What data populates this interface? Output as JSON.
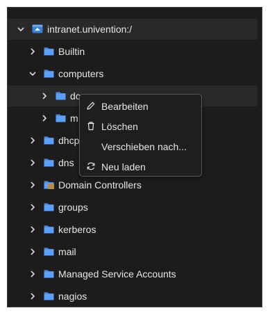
{
  "tree": {
    "root": {
      "label": "intranet.univention:/",
      "icon": "domain-root-icon"
    },
    "items": [
      {
        "label": "Builtin",
        "icon": "folder-icon",
        "expanded": false
      },
      {
        "label": "computers",
        "icon": "folder-icon",
        "expanded": true
      },
      {
        "label": "dc",
        "icon": "folder-icon",
        "expanded": false
      },
      {
        "label": "m",
        "icon": "folder-icon",
        "expanded": false
      },
      {
        "label": "dhcp",
        "icon": "folder-icon",
        "expanded": false
      },
      {
        "label": "dns",
        "icon": "folder-icon",
        "expanded": false
      },
      {
        "label": "Domain Controllers",
        "icon": "container-icon",
        "expanded": false
      },
      {
        "label": "groups",
        "icon": "folder-icon",
        "expanded": false
      },
      {
        "label": "kerberos",
        "icon": "folder-icon",
        "expanded": false
      },
      {
        "label": "mail",
        "icon": "folder-icon",
        "expanded": false
      },
      {
        "label": "Managed Service Accounts",
        "icon": "folder-icon",
        "expanded": false
      },
      {
        "label": "nagios",
        "icon": "folder-icon",
        "expanded": false
      }
    ]
  },
  "context_menu": {
    "items": [
      {
        "label": "Bearbeiten",
        "icon": "pencil-icon"
      },
      {
        "label": "Löschen",
        "icon": "trash-icon"
      },
      {
        "label": "Verschieben nach...",
        "icon": ""
      },
      {
        "label": "Neu laden",
        "icon": "refresh-icon"
      }
    ]
  },
  "colors": {
    "background": "#1c1c1c",
    "folder_blue": "#5aa0ff",
    "text": "#e6e6e6"
  }
}
